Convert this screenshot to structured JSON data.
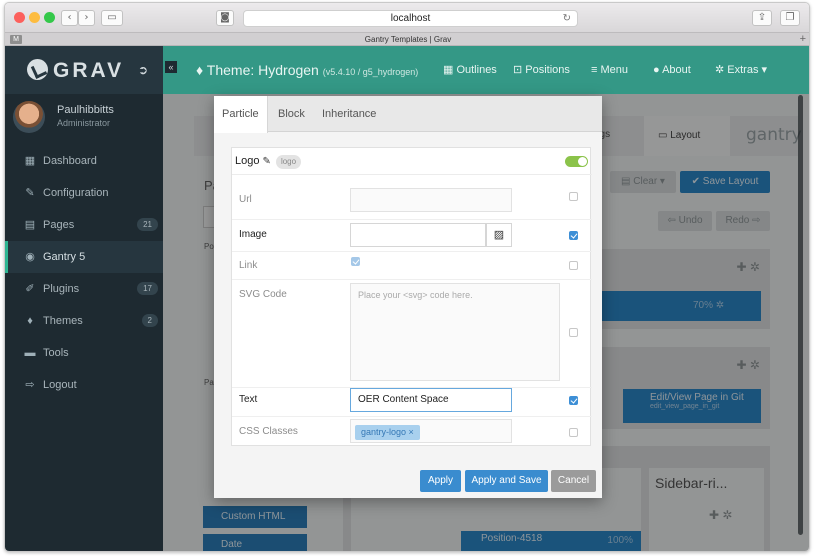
{
  "browser": {
    "url": "localhost",
    "tab_title": "Gantry Templates | Grav",
    "tab_badge": "M"
  },
  "sidebar": {
    "logo": "GRAV",
    "user": {
      "name": "Paulhibbitts",
      "role": "Administrator"
    },
    "items": [
      {
        "label": "Dashboard",
        "icon": "dashboard-icon",
        "glyph": "▦"
      },
      {
        "label": "Configuration",
        "icon": "wrench-icon",
        "glyph": "✎"
      },
      {
        "label": "Pages",
        "icon": "file-icon",
        "glyph": "▤",
        "count": "21"
      },
      {
        "label": "Gantry 5",
        "icon": "gantry-icon",
        "glyph": "◉"
      },
      {
        "label": "Plugins",
        "icon": "plug-icon",
        "glyph": "✐",
        "count": "17"
      },
      {
        "label": "Themes",
        "icon": "droplet-icon",
        "glyph": "♦",
        "count": "2"
      },
      {
        "label": "Tools",
        "icon": "briefcase-icon",
        "glyph": "▬"
      },
      {
        "label": "Logout",
        "icon": "sign-out-icon",
        "glyph": "⇨"
      }
    ]
  },
  "header": {
    "theme_title": "Theme: Hydrogen",
    "version": "(v5.4.10 / g5_hydrogen)",
    "nav": [
      "Outlines",
      "Positions",
      "Menu",
      "About",
      "Extras"
    ]
  },
  "background": {
    "settings_tab": "ngs",
    "layout_tab": "Layout",
    "gantry_brand": "gantry",
    "clear_button": "Clear",
    "save_layout_button": "Save Layout",
    "undo_button": "Undo",
    "redo_button": "Redo",
    "percent_a": "70%",
    "percent_b": "100%",
    "git_block_title": "Edit/View Page in Git",
    "git_block_sub": "edit_view_page_in_git",
    "sidebar_title": "Sidebar-ri...",
    "position_name": "Position-4518",
    "position_sub": "position-4518",
    "custom_html": "Custom HTML",
    "date": "Date",
    "left_fragment": "Pa",
    "pos_label": "Pos",
    "part_label": "Part"
  },
  "modal": {
    "tabs": [
      "Particle",
      "Block",
      "Inheritance"
    ],
    "particle_name": "Logo",
    "particle_chip": "logo",
    "fields": {
      "url_label": "Url",
      "image_label": "Image",
      "link_label": "Link",
      "svg_label": "SVG Code",
      "svg_placeholder": "Place your <svg> code here.",
      "text_label": "Text",
      "text_value": "OER Content Space",
      "css_label": "CSS Classes",
      "css_tag": "gantry-logo"
    },
    "buttons": {
      "apply": "Apply",
      "apply_save": "Apply and Save",
      "cancel": "Cancel"
    }
  }
}
